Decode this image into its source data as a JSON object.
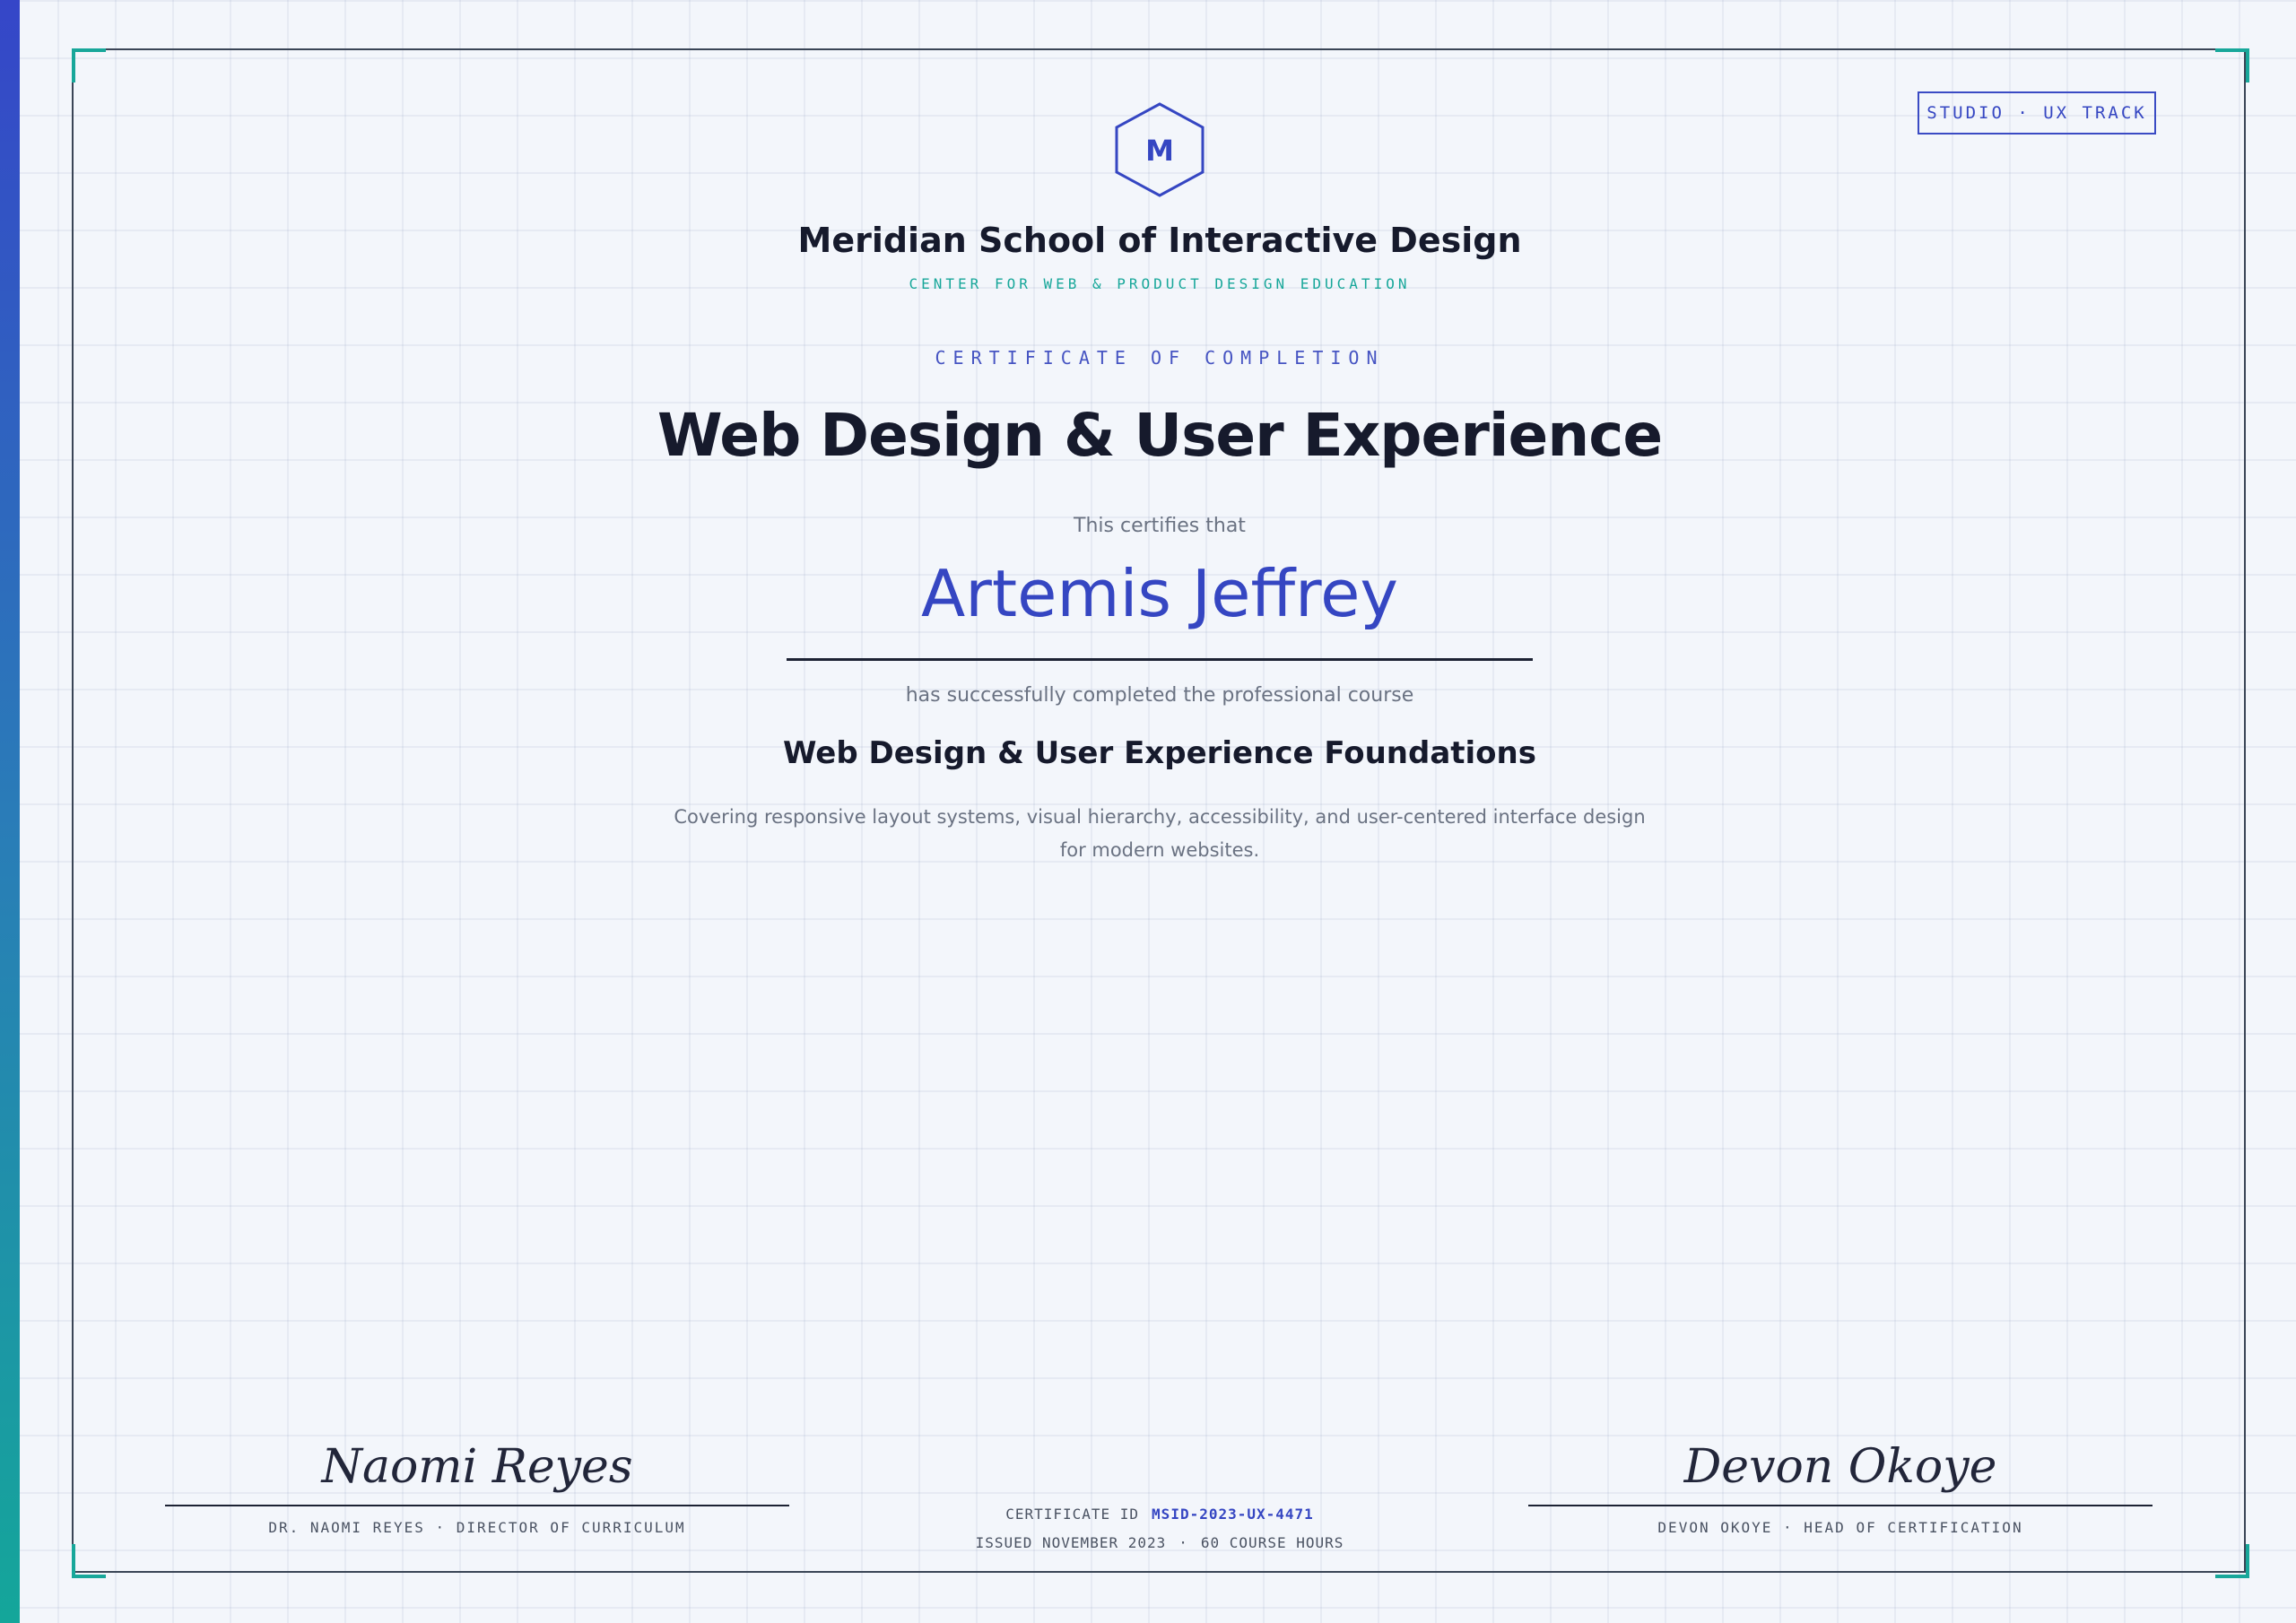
{
  "accent_colors": {
    "primary": "#3546c2",
    "teal": "#18a79a",
    "ink": "#161a2c",
    "muted": "#6a7282"
  },
  "badge": {
    "label": "STUDIO · UX TRACK"
  },
  "logo": {
    "letter": "M",
    "icon": "hexagon-logo-icon"
  },
  "institution": {
    "name": "Meridian School of Interactive Design",
    "subtitle": "CENTER FOR WEB & PRODUCT DESIGN EDUCATION"
  },
  "certificate": {
    "kicker": "CERTIFICATE OF COMPLETION",
    "title": "Web Design & User Experience",
    "certifies_text": "This certifies that",
    "recipient": "Artemis Jeffrey",
    "completed_text": "has successfully completed the professional course",
    "course_name": "Web Design & User Experience Foundations",
    "course_description": "Covering responsive layout systems, visual hierarchy, accessibility, and user-centered interface design for modern websites."
  },
  "signatures": {
    "left": {
      "signature": "Naomi Reyes",
      "title": "DR. NAOMI REYES · DIRECTOR OF CURRICULUM"
    },
    "right": {
      "signature": "Devon Okoye",
      "title": "DEVON OKOYE · HEAD OF CERTIFICATION"
    }
  },
  "meta": {
    "cert_id_label": "CERTIFICATE ID",
    "cert_id_value": "MSID-2023-UX-4471",
    "issued": "ISSUED NOVEMBER 2023",
    "separator": "·",
    "hours": "60 COURSE HOURS"
  }
}
